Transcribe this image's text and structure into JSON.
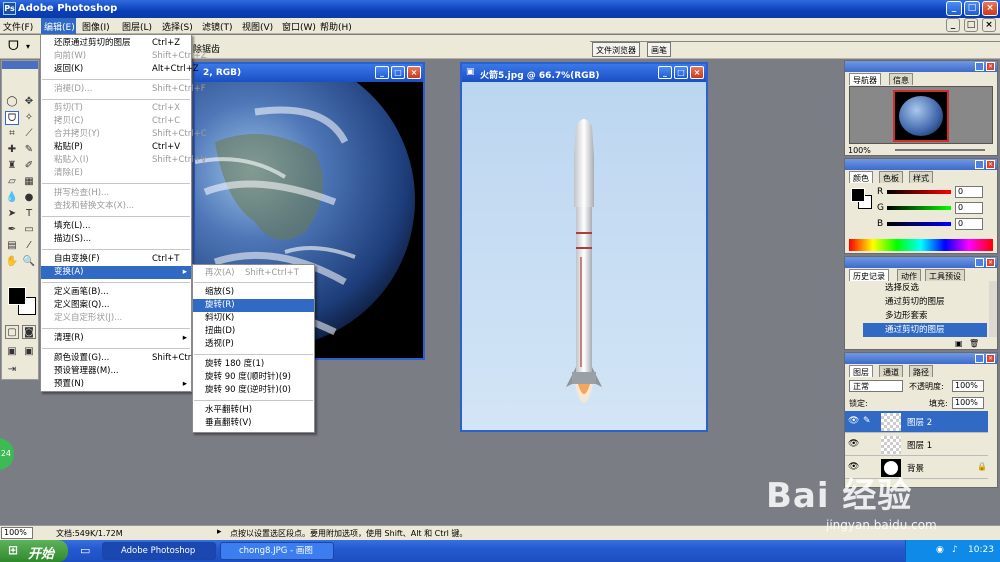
{
  "window": {
    "title": "Adobe Photoshop",
    "min": "_",
    "max": "□",
    "close": "×"
  },
  "menubar": [
    "文件(F)",
    "编辑(E)",
    "图像(I)",
    "图层(L)",
    "选择(S)",
    "滤镜(T)",
    "视图(V)",
    "窗口(W)",
    "帮助(H)"
  ],
  "optbar": {
    "partial_label": "除锯齿",
    "tabs": [
      "文件浏览器",
      "画笔"
    ]
  },
  "edit_menu": [
    {
      "label": "还原通过剪切的图层",
      "sc": "Ctrl+Z",
      "dis": false
    },
    {
      "label": "向前(W)",
      "sc": "Shift+Ctrl+Z",
      "dis": true
    },
    {
      "label": "返回(K)",
      "sc": "Alt+Ctrl+Z",
      "dis": false
    },
    {
      "label": "消褪(D)...",
      "sc": "Shift+Ctrl+F",
      "dis": true
    },
    {
      "label": "剪切(T)",
      "sc": "Ctrl+X",
      "dis": true
    },
    {
      "label": "拷贝(C)",
      "sc": "Ctrl+C",
      "dis": true
    },
    {
      "label": "合并拷贝(Y)",
      "sc": "Shift+Ctrl+C",
      "dis": true
    },
    {
      "label": "粘贴(P)",
      "sc": "Ctrl+V",
      "dis": false
    },
    {
      "label": "粘贴入(I)",
      "sc": "Shift+Ctrl+V",
      "dis": true
    },
    {
      "label": "清除(E)",
      "sc": "",
      "dis": true
    },
    {
      "label": "拼写检查(H)...",
      "sc": "",
      "dis": true
    },
    {
      "label": "查找和替换文本(X)...",
      "sc": "",
      "dis": true
    },
    {
      "label": "填充(L)...",
      "sc": "",
      "dis": false
    },
    {
      "label": "描边(S)...",
      "sc": "",
      "dis": false
    },
    {
      "label": "自由变换(F)",
      "sc": "Ctrl+T",
      "dis": false
    },
    {
      "label": "变换(A)",
      "sc": "",
      "dis": false,
      "arrow": "▸"
    },
    {
      "label": "定义画笔(B)...",
      "sc": "",
      "dis": false
    },
    {
      "label": "定义图案(Q)...",
      "sc": "",
      "dis": false
    },
    {
      "label": "定义自定形状(J)...",
      "sc": "",
      "dis": true
    },
    {
      "label": "清理(R)",
      "sc": "",
      "dis": false,
      "arrow": "▸"
    },
    {
      "label": "颜色设置(G)...",
      "sc": "Shift+Ctrl+K",
      "dis": false
    },
    {
      "label": "预设管理器(M)...",
      "sc": "",
      "dis": false
    },
    {
      "label": "预置(N)",
      "sc": "",
      "dis": false,
      "arrow": "▸"
    }
  ],
  "transform_menu": [
    {
      "label": "再次(A)",
      "sc": "Shift+Ctrl+T",
      "dis": true
    },
    {
      "label": "缩放(S)",
      "dis": false
    },
    {
      "label": "旋转(R)",
      "dis": false
    },
    {
      "label": "斜切(K)",
      "dis": false
    },
    {
      "label": "扭曲(D)",
      "dis": false
    },
    {
      "label": "透视(P)",
      "dis": false
    },
    {
      "label": "旋转 180 度(1)",
      "dis": false
    },
    {
      "label": "旋转 90 度(顺时针)(9)",
      "dis": false
    },
    {
      "label": "旋转 90 度(逆时针)(0)",
      "dis": false
    },
    {
      "label": "水平翻转(H)",
      "dis": false
    },
    {
      "label": "垂直翻转(V)",
      "dis": false
    }
  ],
  "doc_earth": {
    "title": "2, RGB)"
  },
  "doc_rocket": {
    "title": "火箭5.jpg @ 66.7%(RGB)"
  },
  "navigator": {
    "tabs": [
      "导航器",
      "信息"
    ],
    "zoom": "100%"
  },
  "color_panel": {
    "tabs": [
      "颜色",
      "色板",
      "样式"
    ],
    "r_label": "R",
    "g_label": "G",
    "b_label": "B",
    "r": "0",
    "g": "0",
    "b": "0"
  },
  "history": {
    "tabs": [
      "历史记录",
      "动作",
      "工具预设"
    ],
    "items": [
      "选择反选",
      "通过剪切的图层",
      "多边形套索",
      "通过剪切的图层"
    ]
  },
  "layers": {
    "tabs": [
      "图层",
      "通道",
      "路径"
    ],
    "mode": "正常",
    "opacity_label": "不透明度:",
    "opacity": "100%",
    "lock_label": "锁定:",
    "fill_label": "填充:",
    "fill": "100%",
    "items": [
      "图层 2",
      "图层 1",
      "背景"
    ]
  },
  "status": {
    "zoom": "100%",
    "doc": "文档:549K/1.72M",
    "hint": "点按以设置选区段点。要用附加选项，使用 Shift、Alt 和 Ctrl 键。"
  },
  "taskbar": {
    "start": "开始",
    "tasks": [
      "Adobe Photoshop",
      "chong8.JPG - 画图"
    ],
    "time": "10:23"
  },
  "watermark": {
    "brand": "Bai 经验",
    "url": "jingyan.baidu.com"
  },
  "side_badge": "24"
}
